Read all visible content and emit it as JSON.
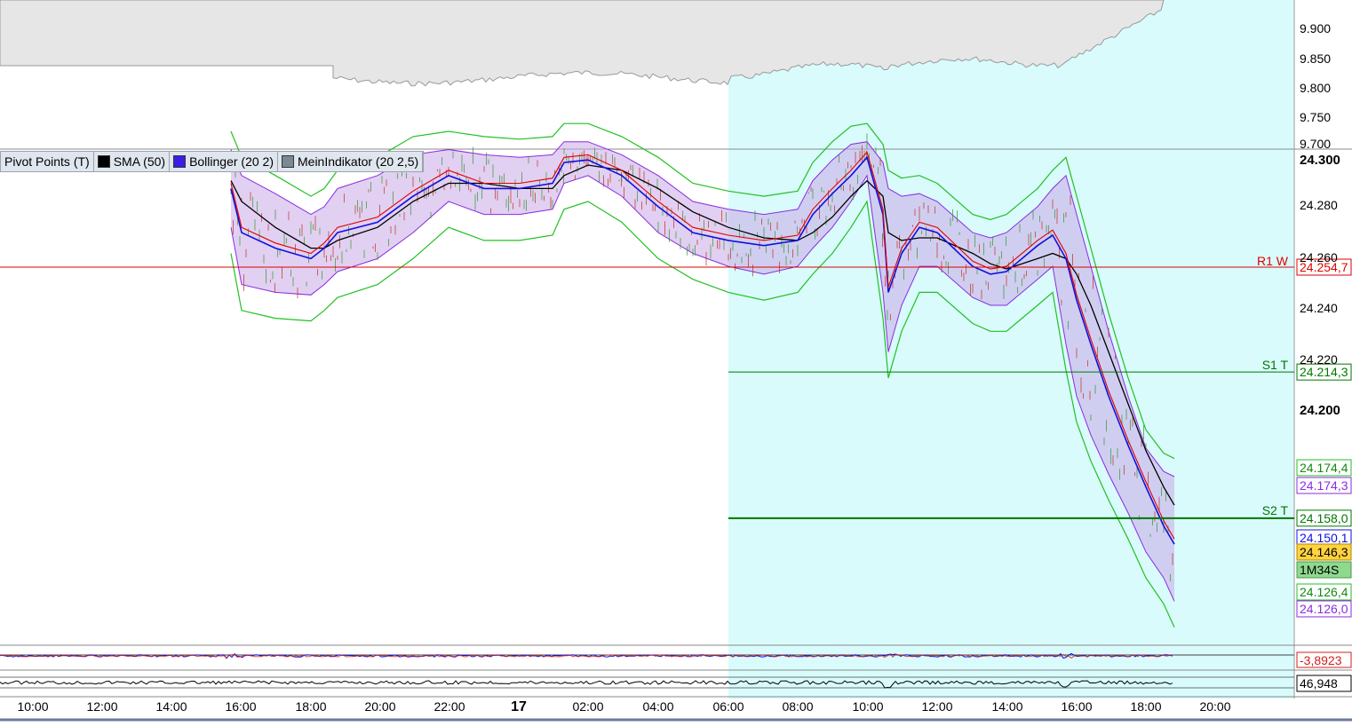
{
  "colors": {
    "background": "#ffffff",
    "session_bg": "#d9fbfc",
    "bollinger_fill": "#c9a9e6",
    "bollinger_line": "#8a2be2",
    "outer_band": "#22c022",
    "sma": "#000000",
    "ema_fast": "#e00000",
    "ema_slow": "#1010e0",
    "pivot_r1": "#e00000",
    "pivot_s": "#007700",
    "price_marker": "#ffd23f",
    "timer_marker": "#8fd98f",
    "upper_panel_fill": "#e6e6e6"
  },
  "legend": {
    "items": [
      {
        "label": "Pivot Points (T)",
        "color": ""
      },
      {
        "label": "SMA (50)",
        "color": "#000000"
      },
      {
        "label": "Bollinger (20 2)",
        "color": "#3a1ee8"
      },
      {
        "label": "MeinIndikator (20 2,5)",
        "color": "#7a8a94"
      }
    ]
  },
  "upper_panel": {
    "axis_labels": [
      "9.900",
      "9.850",
      "9.800",
      "9.750",
      "9.700"
    ]
  },
  "main_panel": {
    "axis_labels": [
      "24.300",
      "24.280",
      "24.260",
      "24.240",
      "24.220",
      "24.200"
    ],
    "pivots": [
      {
        "name": "R1 W",
        "value": "24.254,7"
      },
      {
        "name": "S1 T",
        "value": "24.214,3"
      },
      {
        "name": "S2 T",
        "value": "24.158,0"
      }
    ],
    "price_tags": [
      {
        "value": "24.174,4",
        "kind": "band_upper"
      },
      {
        "value": "24.174,3",
        "kind": "bollinger_upper"
      },
      {
        "value": "24.150,1",
        "kind": "ema"
      },
      {
        "value": "24.146,3",
        "kind": "last"
      },
      {
        "value": "1M34S",
        "kind": "timer"
      },
      {
        "value": "24.126,4",
        "kind": "band_lower"
      },
      {
        "value": "24.126,0",
        "kind": "bollinger_lower"
      }
    ]
  },
  "oscillator_panel": {
    "value": "-3,8923"
  },
  "rsi_panel": {
    "value": "46,948"
  },
  "time_axis": {
    "labels": [
      "10:00",
      "12:00",
      "14:00",
      "16:00",
      "18:00",
      "20:00",
      "22:00",
      "17",
      "02:00",
      "04:00",
      "06:00",
      "08:00",
      "10:00",
      "12:00",
      "14:00",
      "16:00",
      "18:00",
      "20:00"
    ]
  },
  "chart_data": {
    "type": "line",
    "title": "",
    "xlabel": "",
    "ylabel": "",
    "ylim": [
      24.112,
      24.303
    ],
    "x": [
      "15:30",
      "16:00",
      "17:00",
      "18:00",
      "18:30",
      "19:00",
      "20:00",
      "21:00",
      "22:00",
      "23:00",
      "00:00",
      "01:00",
      "01:30",
      "02:00",
      "03:00",
      "04:00",
      "05:00",
      "06:00",
      "07:00",
      "08:00",
      "08:30",
      "09:00",
      "09:30",
      "10:00",
      "10:30",
      "10:45",
      "11:00",
      "11:30",
      "12:00",
      "13:00",
      "13:30",
      "14:00",
      "15:00",
      "15:30",
      "15:45",
      "16:00",
      "16:30",
      "17:00",
      "17:30",
      "18:00",
      "18:30",
      "18:45"
    ],
    "series": [
      {
        "name": "Bollinger (20 2)",
        "values": [
          24.285,
          24.268,
          24.262,
          24.258,
          24.262,
          24.268,
          24.272,
          24.282,
          24.29,
          24.285,
          24.285,
          24.287,
          24.295,
          24.296,
          24.29,
          24.278,
          24.268,
          24.265,
          24.263,
          24.265,
          24.275,
          24.283,
          24.29,
          24.297,
          24.275,
          24.245,
          24.26,
          24.27,
          24.268,
          24.255,
          24.252,
          24.253,
          24.263,
          24.267,
          24.258,
          24.242,
          24.225,
          24.205,
          24.186,
          24.17,
          24.155,
          24.148
        ]
      },
      {
        "name": "SMA (50)",
        "values": [
          24.288,
          24.28,
          24.27,
          24.262,
          24.262,
          24.265,
          24.27,
          24.28,
          24.287,
          24.287,
          24.285,
          24.285,
          24.29,
          24.294,
          24.292,
          24.285,
          24.276,
          24.27,
          24.266,
          24.265,
          24.268,
          24.274,
          24.282,
          24.288,
          24.282,
          24.268,
          24.265,
          24.266,
          24.266,
          24.26,
          24.256,
          24.254,
          24.258,
          24.26,
          24.258,
          24.252,
          24.24,
          24.222,
          24.202,
          24.184,
          24.17,
          24.163
        ]
      },
      {
        "name": "Bollinger upper",
        "values": [
          24.3,
          24.29,
          24.283,
          24.275,
          24.278,
          24.285,
          24.29,
          24.298,
          24.3,
          24.298,
          24.297,
          24.298,
          24.303,
          24.303,
          24.298,
          24.29,
          24.28,
          24.277,
          24.275,
          24.277,
          24.288,
          24.296,
          24.302,
          24.303,
          24.295,
          24.285,
          24.282,
          24.283,
          24.28,
          24.268,
          24.266,
          24.268,
          24.278,
          24.285,
          24.29,
          24.275,
          24.255,
          24.23,
          24.205,
          24.185,
          24.176,
          24.174
        ]
      },
      {
        "name": "Bollinger lower",
        "values": [
          24.27,
          24.248,
          24.245,
          24.244,
          24.248,
          24.253,
          24.258,
          24.268,
          24.28,
          24.275,
          24.275,
          24.277,
          24.287,
          24.29,
          24.282,
          24.268,
          24.26,
          24.255,
          24.252,
          24.255,
          24.262,
          24.27,
          24.28,
          24.29,
          24.245,
          24.222,
          24.24,
          24.255,
          24.255,
          24.243,
          24.24,
          24.24,
          24.25,
          24.255,
          24.225,
          24.205,
          24.19,
          24.175,
          24.16,
          24.145,
          24.135,
          24.126
        ]
      }
    ]
  }
}
